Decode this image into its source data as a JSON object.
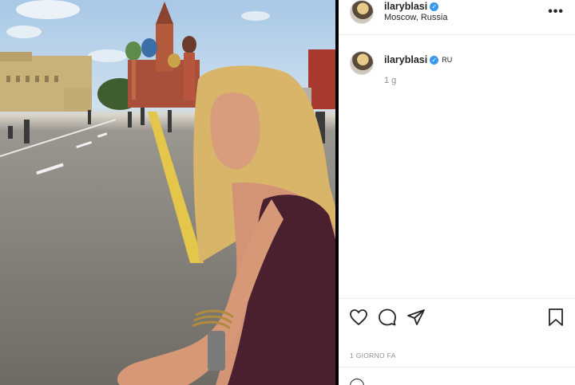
{
  "post": {
    "username": "ilaryblasi",
    "location": "Moscow, Russia",
    "verified": true,
    "more_label": "•••"
  },
  "caption": {
    "username": "ilaryblasi",
    "language_tag": "RU",
    "age": "1 g"
  },
  "actions": {
    "like_icon": "heart-icon",
    "comment_icon": "comment-icon",
    "share_icon": "paper-plane-icon",
    "save_icon": "bookmark-icon"
  },
  "date_label": "1 GIORNO FA",
  "colors": {
    "verified": "#3897f0",
    "text": "#262626",
    "muted": "#8e8e8e"
  }
}
